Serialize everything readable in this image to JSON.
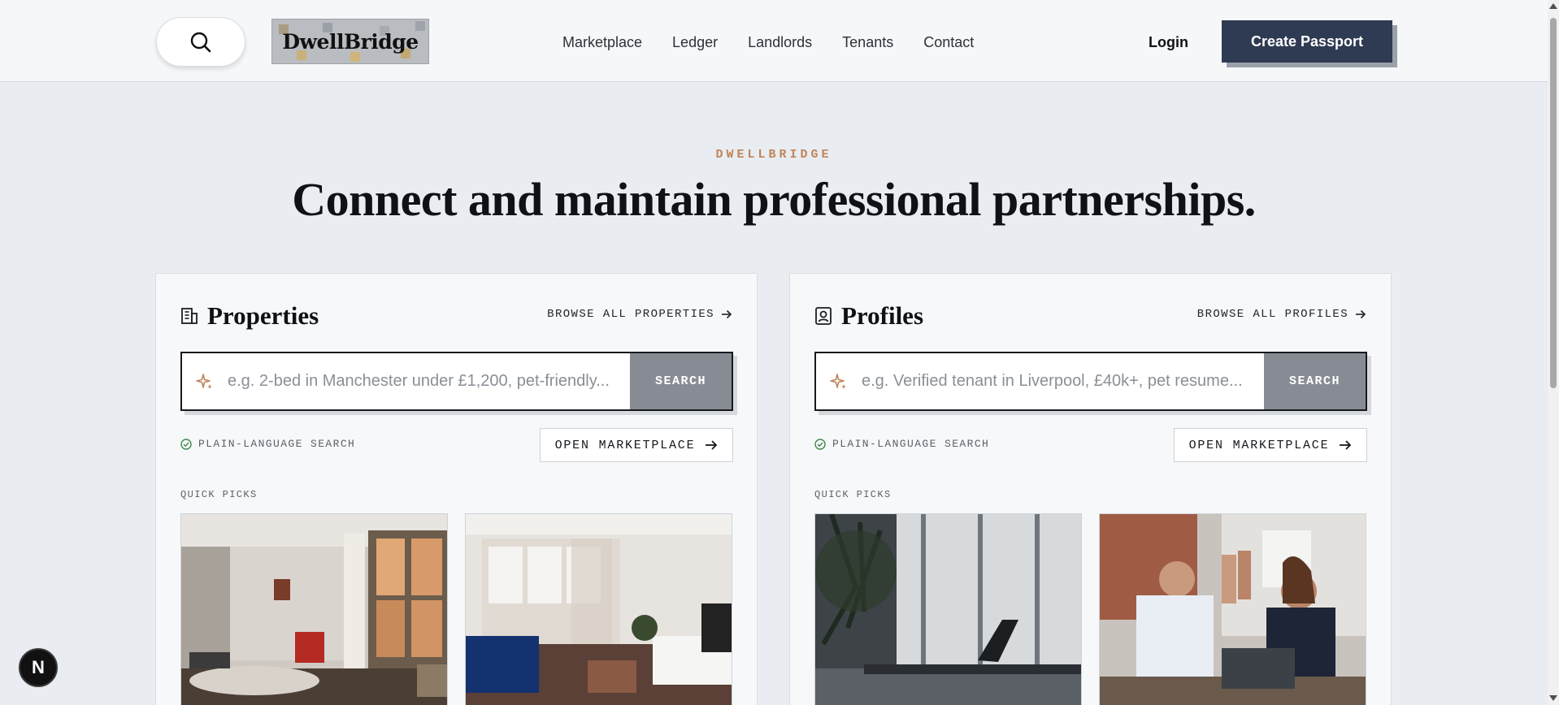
{
  "header": {
    "logo_text": "DwellBridge",
    "nav": [
      "Marketplace",
      "Ledger",
      "Landlords",
      "Tenants",
      "Contact"
    ],
    "login_label": "Login",
    "cta_label": "Create Passport"
  },
  "hero": {
    "eyebrow": "DWELLBRIDGE",
    "title": "Connect and maintain professional partnerships."
  },
  "properties": {
    "title": "Properties",
    "browse_label": "BROWSE ALL PROPERTIES",
    "placeholder": "e.g. 2-bed in Manchester under £1,200, pet-friendly...",
    "search_label": "SEARCH",
    "plain_label": "PLAIN-LANGUAGE SEARCH",
    "open_label": "OPEN MARKETPLACE",
    "quick_label": "QUICK PICKS"
  },
  "profiles": {
    "title": "Profiles",
    "browse_label": "BROWSE ALL PROFILES",
    "placeholder": "e.g. Verified tenant in Liverpool, £40k+, pet resume...",
    "search_label": "SEARCH",
    "plain_label": "PLAIN-LANGUAGE SEARCH",
    "open_label": "OPEN MARKETPLACE",
    "quick_label": "QUICK PICKS"
  },
  "dev_badge": "N",
  "colors": {
    "accent": "#c0845a",
    "cta": "#2f3b52",
    "search_button": "#878c94",
    "background": "#e9edf1"
  },
  "icons": [
    "search-icon",
    "building-icon",
    "profile-card-icon",
    "arrow-right-icon",
    "sparkle-icon",
    "check-circle-icon"
  ]
}
